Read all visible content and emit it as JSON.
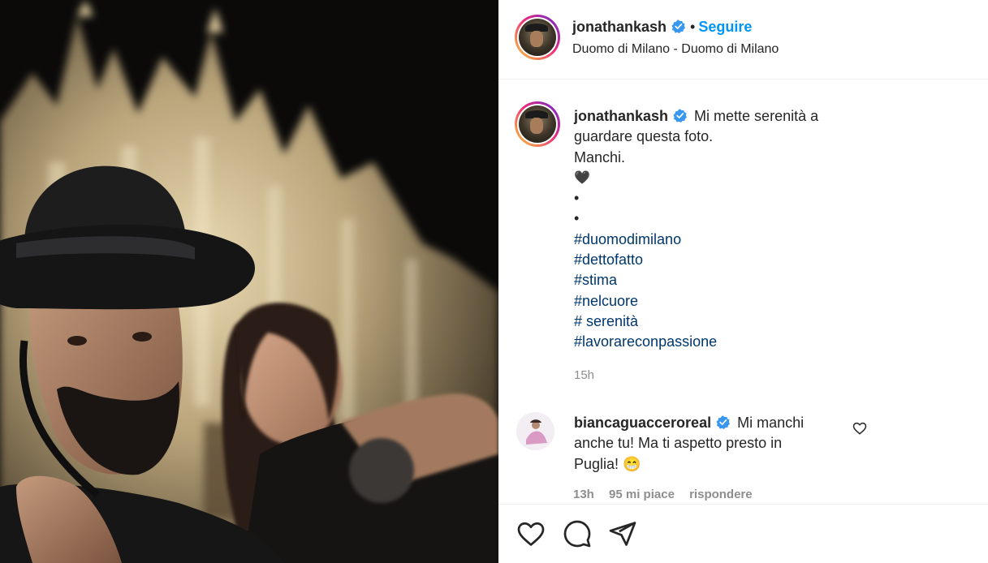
{
  "post": {
    "author": "jonathankash",
    "follow_label": "Seguire",
    "separator": "•",
    "location": "Duomo di Milano - Duomo di Milano"
  },
  "caption": {
    "author": "jonathankash",
    "first_line": "Mi mette serenità a",
    "second_line": "guardare questa foto.",
    "third_line": "Manchi.",
    "heart": "🖤",
    "dot1": "•",
    "dot2": "•",
    "hashtags": [
      "#duomodimilano",
      "#dettofatto",
      "#stima",
      "#nelcuore",
      "# serenità",
      "#lavorareconpassione"
    ],
    "time": "15h"
  },
  "comment": {
    "author": "biancaguaccerorea",
    "author_full": "biancaguacceroreal",
    "text_line1": "Mi manchi",
    "text_line2": "anche tu! Ma ti aspetto presto in",
    "text_line3": "Puglia! 😁",
    "time": "13h",
    "likes": "95 mi piace",
    "reply": "rispondere"
  },
  "icons": {
    "verified": "verified-badge-icon",
    "like": "heart-icon",
    "comment": "comment-bubble-icon",
    "share": "paper-plane-icon",
    "comment_like": "small-heart-icon"
  },
  "colors": {
    "link": "#0095f6",
    "hashtag": "#00376b",
    "muted": "#8e8e8e",
    "verified": "#3897f0"
  }
}
